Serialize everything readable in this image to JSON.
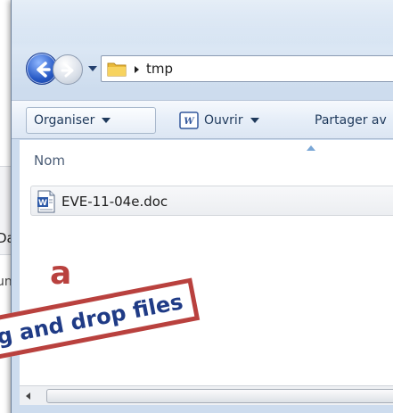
{
  "background": {
    "fragment_1": "Da",
    "fragment_2": "un"
  },
  "navigation": {
    "back_icon": "back-arrow-icon",
    "forward_icon": "forward-arrow-icon",
    "history_icon": "chevron-down-icon"
  },
  "address_bar": {
    "folder_icon": "folder-icon",
    "path": "tmp"
  },
  "command_bar": {
    "organise_label": "Organiser",
    "open_label": "Ouvrir",
    "share_label": "Partager av"
  },
  "file_list": {
    "column_name": "Nom",
    "files": [
      {
        "name": "EVE-11-04e.doc",
        "icon": "word-document-icon"
      }
    ]
  },
  "overlay": {
    "panel_letter": "a",
    "caption": "g and drop files"
  },
  "colors": {
    "accent_red": "#b9413e",
    "caption_blue": "#1f3b86",
    "command_text": "#1e395b"
  }
}
